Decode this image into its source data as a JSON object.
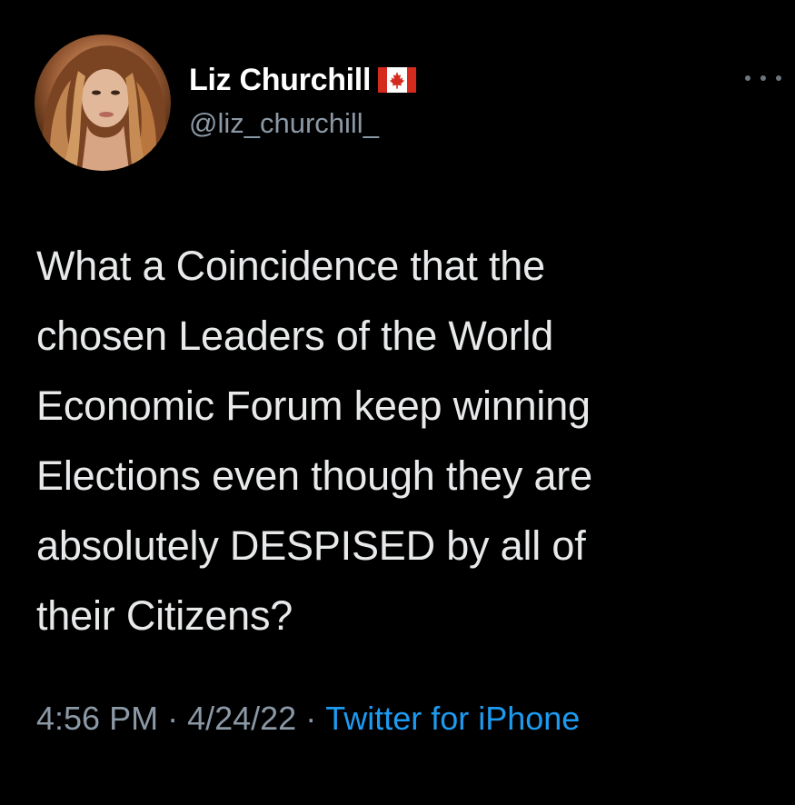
{
  "tweet": {
    "author": {
      "display_name": "Liz Churchill",
      "flag_icon": "canada-flag-icon",
      "handle": "@liz_churchill_"
    },
    "more_icon": "more-options-icon",
    "text": "What a Coincidence that the\nchosen Leaders of the World\nEconomic Forum keep winning\nElections even though they are\nabsolutely DESPISED by all of\ntheir Citizens?",
    "meta": {
      "time": "4:56 PM",
      "separator": "·",
      "date": "4/24/22",
      "source": "Twitter for iPhone"
    }
  },
  "colors": {
    "background": "#000000",
    "primary_text": "#e7e9ea",
    "secondary_text": "#8b98a5",
    "link": "#1d9bf0",
    "flag_red": "#d52b1e"
  }
}
